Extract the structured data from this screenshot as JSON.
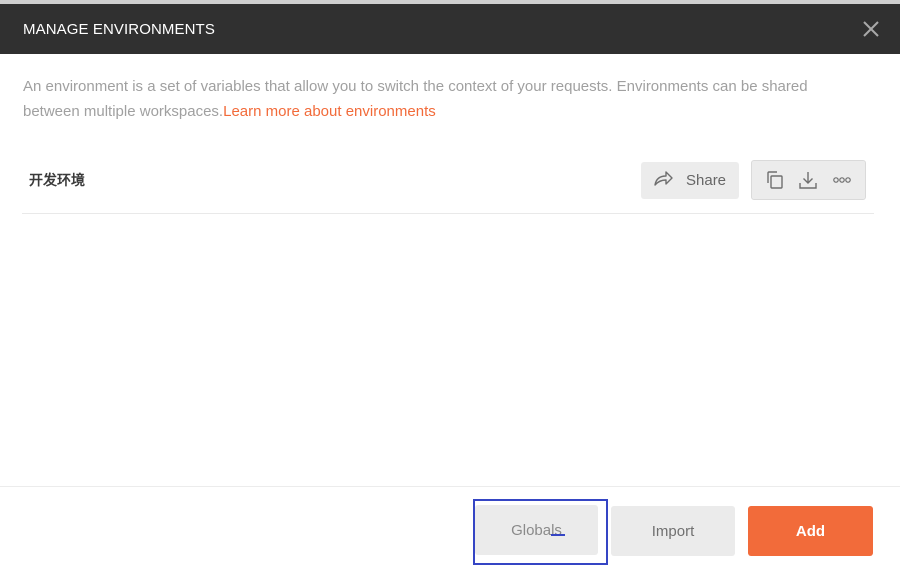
{
  "modal": {
    "title": "MANAGE ENVIRONMENTS",
    "close_icon": "close-icon"
  },
  "description": {
    "text": "An environment is a set of variables that allow you to switch the context of your requests. Environments can be shared between multiple workspaces.",
    "link": "Learn more about environments"
  },
  "environments": [
    {
      "name": "开发环境",
      "share_label": "Share",
      "icons": [
        "share-arrow-icon",
        "duplicate-icon",
        "download-icon",
        "more-icon"
      ]
    }
  ],
  "footer": {
    "globals_label": "Globals",
    "import_label": "Import",
    "add_label": "Add"
  },
  "colors": {
    "header_bg": "#303030",
    "accent": "#f26b3a",
    "focus_ring": "#3545c4",
    "button_bg": "#ebebeb"
  }
}
